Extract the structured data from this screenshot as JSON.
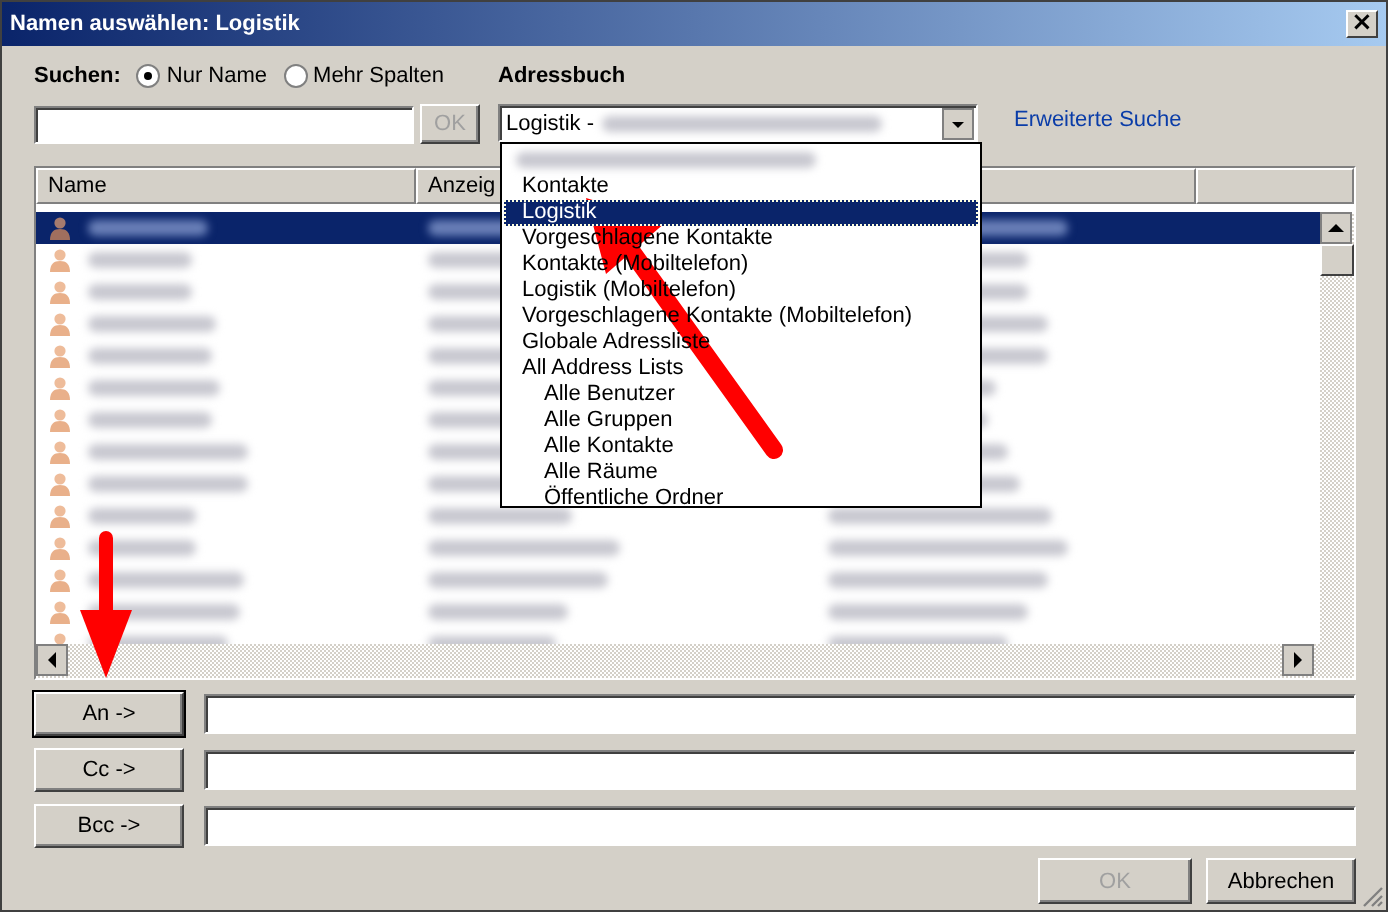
{
  "window": {
    "title": "Namen auswählen: Logistik",
    "close": "×"
  },
  "search": {
    "label": "Suchen:",
    "options": [
      {
        "label": "Nur Name",
        "selected": true
      },
      {
        "label": "Mehr Spalten",
        "selected": false
      }
    ],
    "ok": "OK"
  },
  "address_book": {
    "label": "Adressbuch",
    "value": "Logistik -",
    "items": [
      {
        "label": "Kontakte",
        "selected": false
      },
      {
        "label": "Logistik",
        "selected": true
      },
      {
        "label": "Vorgeschlagene Kontakte",
        "selected": false
      },
      {
        "label": "Kontakte (Mobiltelefon)",
        "selected": false
      },
      {
        "label": "Logistik (Mobiltelefon)",
        "selected": false
      },
      {
        "label": "Vorgeschlagene Kontakte (Mobiltelefon)",
        "selected": false
      },
      {
        "label": "Globale Adressliste",
        "selected": false
      },
      {
        "label": "All Address Lists",
        "selected": false,
        "children": [
          {
            "label": "Alle Benutzer",
            "selected": false
          },
          {
            "label": "Alle Gruppen",
            "selected": false
          },
          {
            "label": "Alle Kontakte",
            "selected": false
          },
          {
            "label": "Alle Räume",
            "selected": false
          },
          {
            "label": "Öffentliche Ordner",
            "selected": false
          }
        ]
      }
    ]
  },
  "advanced_search": "Erweiterte Suche",
  "table": {
    "columns": [
      "Name",
      "Anzeig"
    ],
    "rows": [
      {
        "selected": true
      },
      {
        "selected": false
      },
      {
        "selected": false
      },
      {
        "selected": false
      },
      {
        "selected": false
      },
      {
        "selected": false
      },
      {
        "selected": false
      },
      {
        "selected": false
      },
      {
        "selected": false
      },
      {
        "selected": false
      },
      {
        "selected": false
      },
      {
        "selected": false
      },
      {
        "selected": false
      },
      {
        "selected": false
      }
    ]
  },
  "recipients": [
    {
      "button": "An ->",
      "default": true
    },
    {
      "button": "Cc ->",
      "default": false
    },
    {
      "button": "Bcc ->",
      "default": false
    }
  ],
  "buttons": [
    {
      "label": "OK",
      "disabled": true
    },
    {
      "label": "Abbrechen",
      "disabled": false
    }
  ]
}
